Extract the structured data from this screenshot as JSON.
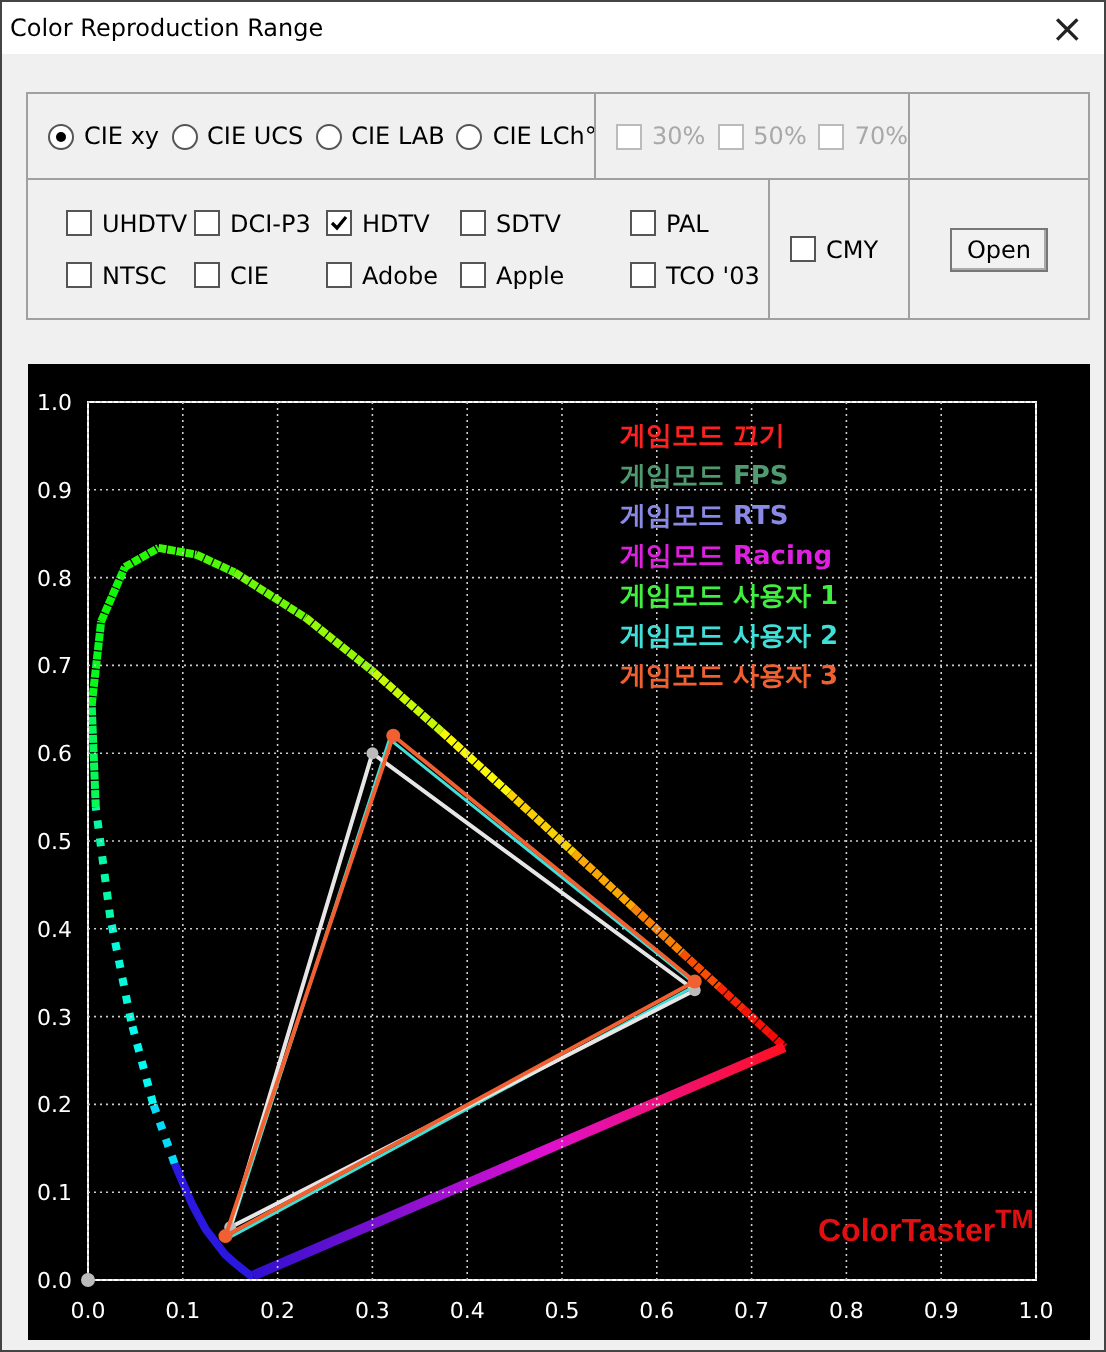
{
  "window": {
    "title": "Color Reproduction Range",
    "close": "×"
  },
  "color_spaces": [
    {
      "label": "CIE xy",
      "selected": true
    },
    {
      "label": "CIE UCS",
      "selected": false
    },
    {
      "label": "CIE LAB",
      "selected": false
    },
    {
      "label": "CIE LCh°",
      "selected": false
    }
  ],
  "coverage": [
    {
      "label": "30%",
      "checked": false,
      "disabled": true
    },
    {
      "label": "50%",
      "checked": false,
      "disabled": true
    },
    {
      "label": "70%",
      "checked": false,
      "disabled": true
    }
  ],
  "standards": [
    {
      "label": "UHDTV",
      "checked": false
    },
    {
      "label": "DCI-P3",
      "checked": false
    },
    {
      "label": "HDTV",
      "checked": true
    },
    {
      "label": "SDTV",
      "checked": false
    },
    {
      "label": "PAL",
      "checked": false
    },
    {
      "label": "NTSC",
      "checked": false
    },
    {
      "label": "CIE",
      "checked": false
    },
    {
      "label": "Adobe",
      "checked": false
    },
    {
      "label": "Apple",
      "checked": false
    },
    {
      "label": "TCO '03",
      "checked": false
    }
  ],
  "cmy": {
    "label": "CMY",
    "checked": false
  },
  "open_button": "Open",
  "chart": {
    "brand": "ColorTaster$^{TM}$",
    "chart_data": {
      "type": "scatter",
      "grid": true,
      "xlim": [
        0,
        1
      ],
      "ylim": [
        0,
        1
      ],
      "xticks": [
        {
          "value": 0,
          "label": "0.0"
        },
        {
          "value": 0.1,
          "label": "0.1"
        },
        {
          "value": 0.2,
          "label": "0.2"
        },
        {
          "value": 0.3,
          "label": "0.3"
        },
        {
          "value": 0.4,
          "label": "0.4"
        },
        {
          "value": 0.5,
          "label": "0.5"
        },
        {
          "value": 0.6,
          "label": "0.6"
        },
        {
          "value": 0.7,
          "label": "0.7"
        },
        {
          "value": 0.8,
          "label": "0.8"
        },
        {
          "value": 0.9,
          "label": "0.9"
        },
        {
          "value": 1,
          "label": "1.0"
        }
      ],
      "yticks": [
        {
          "value": 0,
          "label": "0.0"
        },
        {
          "value": 0.1,
          "label": "0.1"
        },
        {
          "value": 0.2,
          "label": "0.2"
        },
        {
          "value": 0.3,
          "label": "0.3"
        },
        {
          "value": 0.4,
          "label": "0.4"
        },
        {
          "value": 0.5,
          "label": "0.5"
        },
        {
          "value": 0.6,
          "label": "0.6"
        },
        {
          "value": 0.7,
          "label": "0.7"
        },
        {
          "value": 0.8,
          "label": "0.8"
        },
        {
          "value": 0.9,
          "label": "0.9"
        },
        {
          "value": 1,
          "label": "1.0"
        }
      ],
      "series": [
        {
          "name": "게임모드 끄기",
          "color": "#ff2020"
        },
        {
          "name": "게임모드 FPS",
          "color": "#4f9a6e"
        },
        {
          "name": "게임모드 RTS",
          "color": "#8a8ae6"
        },
        {
          "name": "게임모드 Racing",
          "color": "#e020e0"
        },
        {
          "name": "게임모드 사용자 1",
          "color": "#40f040"
        },
        {
          "name": "게임모드 사용자 2",
          "color": "#40e0d8"
        },
        {
          "name": "게임모드 사용자 3",
          "color": "#f06030",
          "x": [
            0.64,
            0.322,
            0.145
          ],
          "values": [
            0.34,
            0.62,
            0.05
          ]
        }
      ]
    }
  }
}
